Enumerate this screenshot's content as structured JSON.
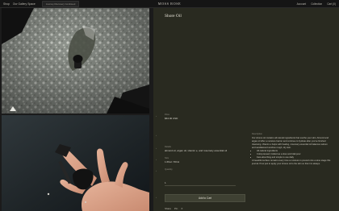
{
  "topbar": {
    "nav_shop": "Shop",
    "nav_gallery": "Our Gallery Space",
    "search_placeholder": "Journey Discovery Continued",
    "brand": "MOSS ROSE",
    "account": "Account",
    "collection": "Collection",
    "cart": "Cart (0)"
  },
  "product": {
    "title": "Shore Oil",
    "price_label": "Price",
    "price": "$64.00 USD",
    "description_label": "Description",
    "description": "Our shores oil contains all natural ingredients that soothe your skin. Almond and argan oil offer a moisture barrier and continue to hydrate after you've finished cleansing. Vitamin e helps with healing, rosemary essential oil balances sebum and sandalwood soothes rough, dry skin.",
    "bullets": [
      "All-natural ingredients",
      "Cold-pressed, bottled as a slow and tidal pour",
      "Fast-absorbing and simple to use daily"
    ],
    "note": "A beautiful surface remains every time a moisture is poured onto a wine stage this journal. Pour just to apply your shores oil to the skin so that it is always.",
    "ingredients_label": "Details",
    "ingredients": "almond oil, argan oil, vitamin e, and rosemary essential oil",
    "size_label": "Size",
    "size": "1.69oz / 50ml",
    "quantity_label": "Quantity",
    "quantity": "1",
    "add_button": "Add to Cart",
    "share_label": "Share",
    "share_pin": "Pin",
    "share_tweet": "X"
  },
  "gallery": {
    "photo1_icon": "stone-bottle-photo",
    "photo2_icon": "hand-dropper-photo"
  },
  "colors": {
    "panel": "#292a20",
    "button": "#3f4133",
    "page": "#1b1b1b"
  }
}
